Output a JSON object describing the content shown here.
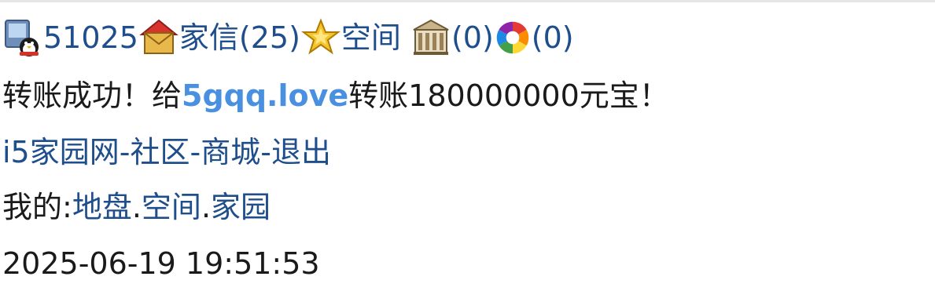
{
  "top_bar": {
    "user_id": "51025",
    "mail_label": "家信",
    "mail_count": "(25)",
    "space_label": "空间",
    "building_count": "(0)",
    "photo_count": "(0)"
  },
  "message": {
    "prefix": "转账成功！给",
    "recipient": "5gqq.love",
    "suffix": "转账180000000元宝！"
  },
  "nav": {
    "home": "i5家园网",
    "sep1": "-",
    "community": "社区",
    "sep2": "-",
    "mall": "商城",
    "sep3": "-",
    "logout": "退出"
  },
  "mine": {
    "label": "我的:",
    "land": "地盘",
    "dot1": ".",
    "space": "空间",
    "dot2": ".",
    "home": "家园"
  },
  "footer": {
    "datetime": "2025-06-19 19:51:53"
  },
  "icons": {
    "user": "qq-penguin-computer-icon",
    "mail": "house-mail-icon",
    "space": "star-icon",
    "building": "building-icon",
    "photo": "aperture-icon"
  }
}
